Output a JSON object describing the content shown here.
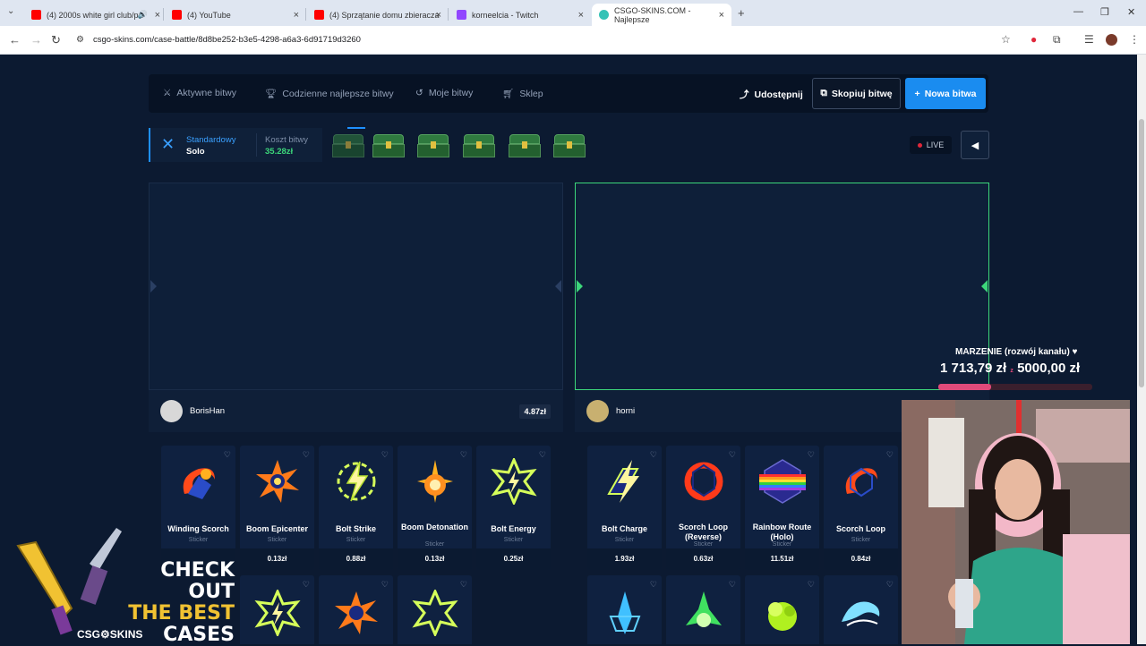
{
  "browser": {
    "tabs": [
      {
        "title": "(4) 2000s white girl club/pa",
        "favicon_color": "#ff0000"
      },
      {
        "title": "(4) YouTube",
        "favicon_color": "#ff0000"
      },
      {
        "title": "(4) Sprzątanie domu zbieracza",
        "favicon_color": "#ff0000"
      },
      {
        "title": "korneelcia - Twitch",
        "favicon_color": "#9146ff"
      },
      {
        "title": "CSGO-SKINS.COM - Najlepsze",
        "favicon_color": "#35c2b6"
      }
    ],
    "url": "csgo-skins.com/case-battle/8d8be252-b3e5-4298-a6a3-6d91719d3260"
  },
  "site": {
    "nav": {
      "active_battles": "Aktywne bitwy",
      "daily_best": "Codzienne najlepsze bitwy",
      "my_battles": "Moje bitwy",
      "shop": "Sklep",
      "share": "Udostępnij",
      "copy_battle": "Skopiuj bitwę",
      "new_battle": "Nowa bitwa"
    },
    "battle": {
      "mode": "Standardowy",
      "mode_sub": "Solo",
      "cost_label": "Koszt bitwy",
      "cost_value": "35.28zł",
      "live_label": "LIVE"
    },
    "players": [
      {
        "name": "BorisHan",
        "total": "4.87zł",
        "items": [
          {
            "name": "Winding Scorch",
            "type": "Sticker",
            "price": "",
            "art": "fire"
          },
          {
            "name": "Boom Epicenter",
            "type": "Sticker",
            "price": "0.13zł",
            "art": "boom"
          },
          {
            "name": "Bolt Strike",
            "type": "Sticker",
            "price": "0.88zł",
            "art": "bolt"
          },
          {
            "name": "Boom Detonation",
            "type": "Sticker",
            "price": "0.13zł",
            "art": "blast"
          },
          {
            "name": "Bolt Energy",
            "type": "Sticker",
            "price": "0.25zł",
            "art": "bolt"
          }
        ]
      },
      {
        "name": "horni",
        "total": "",
        "items": [
          {
            "name": "Bolt Charge",
            "type": "Sticker",
            "price": "1.93zł",
            "art": "bolt"
          },
          {
            "name": "Scorch Loop (Reverse)",
            "type": "Sticker",
            "price": "0.63zł",
            "art": "fire"
          },
          {
            "name": "Rainbow Route (Holo)",
            "type": "Sticker",
            "price": "11.51zł",
            "art": "rainbow"
          },
          {
            "name": "Scorch Loop",
            "type": "Sticker",
            "price": "0.84zł",
            "art": "fire"
          }
        ]
      }
    ]
  },
  "overlay": {
    "goal_title": "MARZENIE (rozwój kanału) ♥",
    "goal_current": "1 713,79 zł",
    "goal_target": "5000,00 zł",
    "goal_progress": 0.343,
    "promo_line1": "CHECK OUT",
    "promo_line2": "THE BEST",
    "promo_line3": "CASES",
    "promo_brand": "CSG⚙SKINS"
  },
  "colors": {
    "accent_blue": "#1a8cf0",
    "accent_green": "#3cd67a",
    "page_bg": "#0c1a31"
  }
}
